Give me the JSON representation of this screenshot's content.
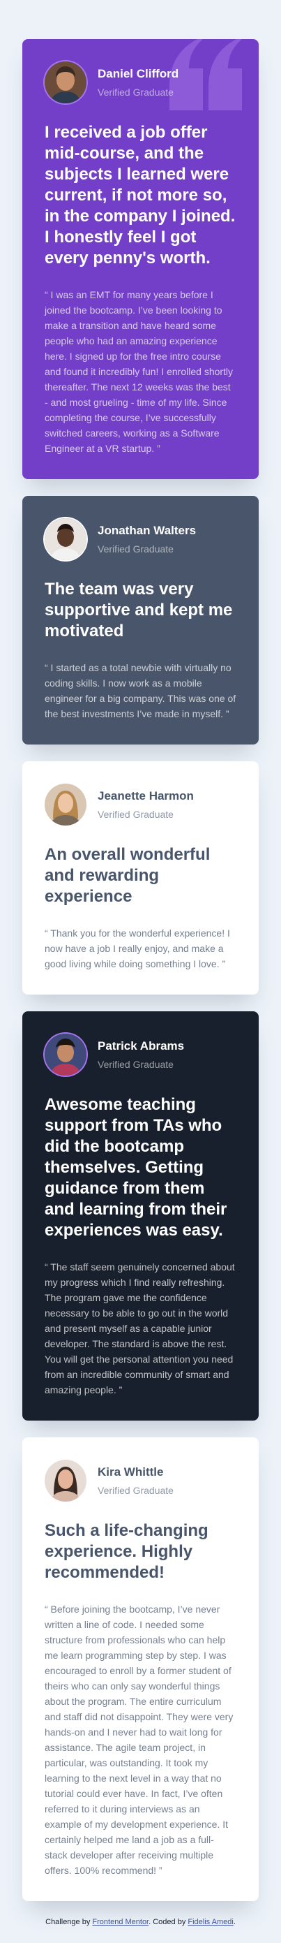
{
  "colors": {
    "purple": "#733fc8",
    "slate": "#48556a",
    "white": "#ffffff",
    "dark": "#19202d",
    "background": "#ecf2f8"
  },
  "testimonials": [
    {
      "name": "Daniel Clifford",
      "role": "Verified Graduate",
      "headline": "I received a job offer mid-course, and the subjects I learned were current, if not more so, in the company I joined. I honestly feel I got every penny's worth.",
      "body": "“ I was an EMT for many years before I joined the bootcamp. I’ve been looking to make a transition and have heard some people who had an amazing experience here. I signed up for the free intro course and found it incredibly fun! I enrolled shortly thereafter. The next 12 weeks was the best - and most grueling - time of my life. Since completing the course, I’ve successfully switched careers, working as a Software Engineer at a VR startup. ”",
      "icon": "quotation-mark-icon"
    },
    {
      "name": "Jonathan Walters",
      "role": "Verified Graduate",
      "headline": "The team was very supportive and kept me motivated",
      "body": "“ I started as a total newbie with virtually no coding skills. I now work as a mobile engineer for a big company. This was one of the best investments I’ve made in myself. ”"
    },
    {
      "name": "Jeanette Harmon",
      "role": "Verified Graduate",
      "headline": "An overall wonderful and rewarding experience",
      "body": "“ Thank you for the wonderful experience! I now have a job I really enjoy, and make a good living while doing something I love. ”"
    },
    {
      "name": "Patrick Abrams",
      "role": "Verified Graduate",
      "headline": "Awesome teaching support from TAs who did the bootcamp themselves. Getting guidance from them and learning from their experiences was easy.",
      "body": "“ The staff seem genuinely concerned about my progress which I find really refreshing. The program gave me the confidence necessary to be able to go out in the world and present myself as a capable junior developer. The standard is above the rest. You will get the personal attention you need from an incredible community of smart and amazing people. ”"
    },
    {
      "name": "Kira Whittle",
      "role": "Verified Graduate",
      "headline": "Such a life-changing experience. Highly recommended!",
      "body": "“ Before joining the bootcamp, I’ve never written a line of code. I needed some structure from professionals who can help me learn programming step by step. I was encouraged to enroll by a former student of theirs who can only say wonderful things about the program. The entire curriculum and staff did not disappoint. They were very hands-on and I never had to wait long for assistance. The agile team project, in particular, was outstanding. It took my learning to the next level in a way that no tutorial could ever have. In fact, I’ve often referred to it during interviews as an example of my development experience. It certainly helped me land a job as a full-stack developer after receiving multiple offers. 100% recommend! ”"
    }
  ],
  "attribution": {
    "prefix": "Challenge by ",
    "link1": "Frontend Mentor",
    "middle": ". Coded by ",
    "link2": "Fidelis Amedi",
    "suffix": "."
  }
}
